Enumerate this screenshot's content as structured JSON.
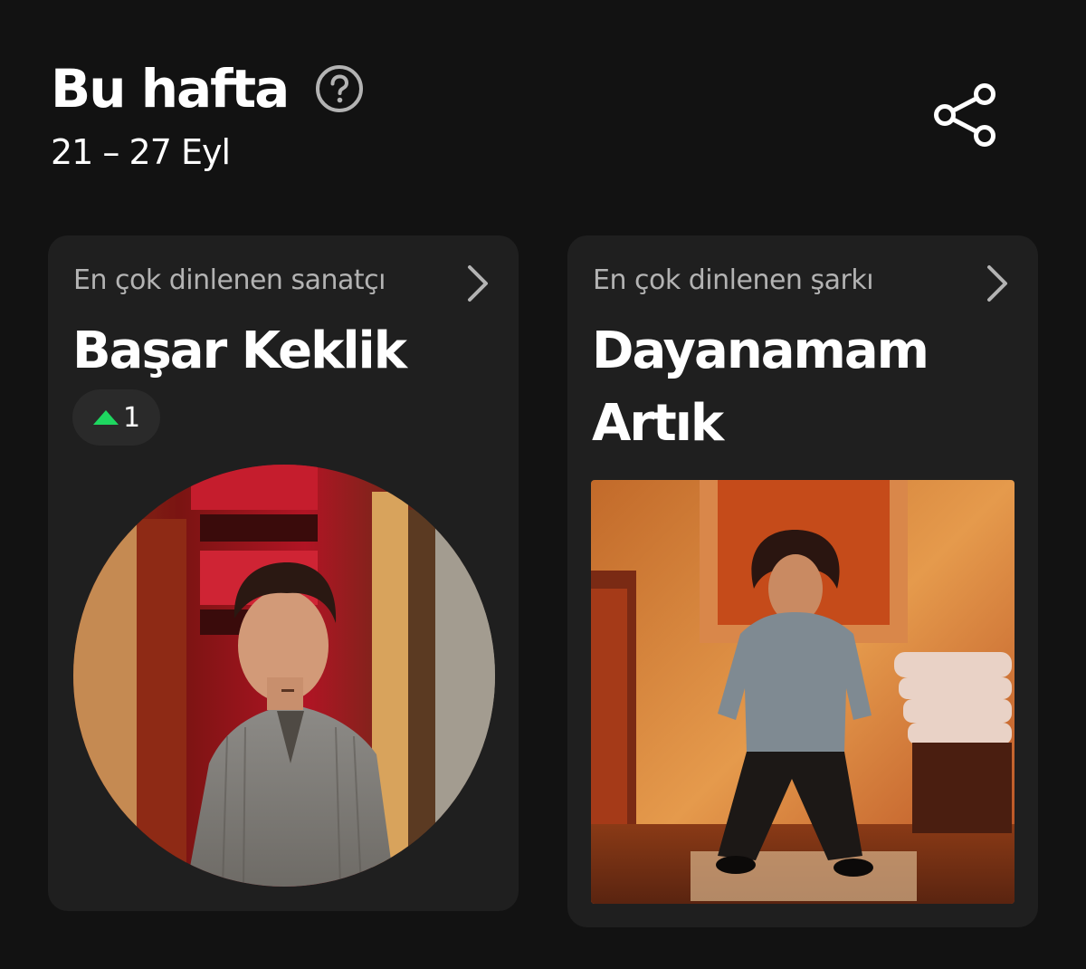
{
  "header": {
    "title": "Bu hafta",
    "date_range": "21 – 27 Eyl",
    "help_icon": "help-circle-icon",
    "share_icon": "share-icon"
  },
  "cards": [
    {
      "label": "En çok dinlenen sanatçı",
      "title": "Başar Keklik",
      "rank_change": "1",
      "rank_direction": "up",
      "chevron_icon": "chevron-right-icon"
    },
    {
      "label": "En çok dinlenen şarkı",
      "title": "Dayanamam Artık",
      "chevron_icon": "chevron-right-icon"
    }
  ],
  "colors": {
    "background": "#121212",
    "card": "#1f1f1f",
    "label": "#b3b3b3",
    "accent_up": "#1ed760"
  }
}
